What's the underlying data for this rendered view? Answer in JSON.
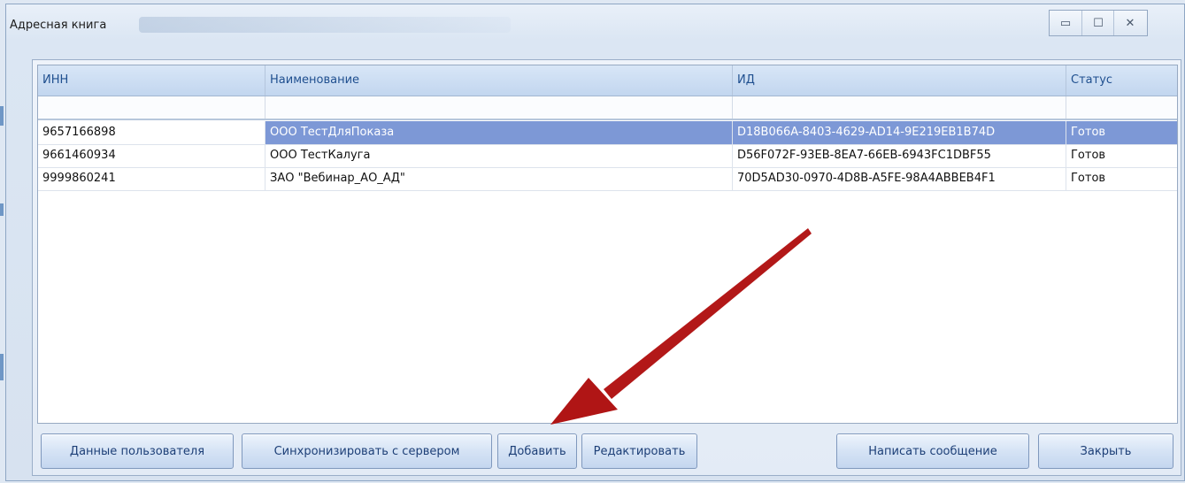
{
  "window": {
    "title": "Адресная книга",
    "minimize_glyph": "▭",
    "maximize_glyph": "☐",
    "close_glyph": "✕"
  },
  "grid": {
    "columns": [
      "ИНН",
      "Наименование",
      "ИД",
      "Статус"
    ],
    "rows": [
      {
        "inn": "9657166898",
        "name": "ООО ТестДляПоказа",
        "id": "D18B066A-8403-4629-AD14-9E219EB1B74D",
        "status": "Готов",
        "selected": true
      },
      {
        "inn": "9661460934",
        "name": "ООО ТестКалуга",
        "id": "D56F072F-93EB-8EA7-66EB-6943FC1DBF55",
        "status": "Готов",
        "selected": false
      },
      {
        "inn": "9999860241",
        "name": "ЗАО \"Вебинар_АО_АД\"",
        "id": "70D5AD30-0970-4D8B-A5FE-98A4ABBEB4F1",
        "status": "Готов",
        "selected": false
      }
    ]
  },
  "buttons": {
    "user_data": "Данные пользователя",
    "sync": "Синхронизировать с сервером",
    "add": "Добавить",
    "edit": "Редактировать",
    "write_message": "Написать сообщение",
    "close": "Закрыть"
  },
  "colors": {
    "selection": "#7d98d6",
    "header_text": "#1f4f8f",
    "arrow": "#b01515"
  }
}
